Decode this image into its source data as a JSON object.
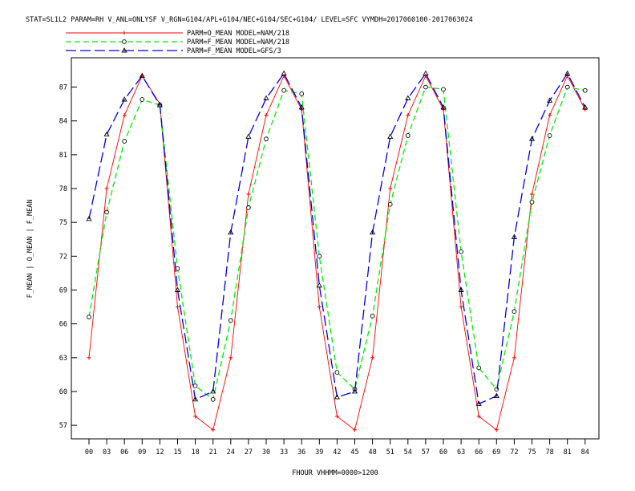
{
  "chart_data": {
    "type": "line",
    "title": "STAT=SL1L2 PARAM=RH V_ANL=ONLYSF V_RGN=G104/APL+G104/NEC+G104/SEC+G104/ LEVEL=SFC VYMDH=2017060100-2017063024",
    "xlabel": "FHOUR VHHMM=0000>1200",
    "ylabel": "F_MEAN | O_MEAN | F_MEAN",
    "categories": [
      "00",
      "03",
      "06",
      "09",
      "12",
      "15",
      "18",
      "21",
      "24",
      "27",
      "30",
      "33",
      "36",
      "39",
      "42",
      "45",
      "48",
      "51",
      "54",
      "57",
      "60",
      "63",
      "66",
      "69",
      "72",
      "75",
      "78",
      "81",
      "84"
    ],
    "y_ticks": [
      "57",
      "60",
      "63",
      "66",
      "69",
      "72",
      "75",
      "78",
      "81",
      "84",
      "87"
    ],
    "ylim": [
      55.8,
      89.6
    ],
    "grid": false,
    "legend_position": "top-left",
    "series": [
      {
        "name": "PARM=O_MEAN MODEL=NAM/218",
        "color": "#ff0000",
        "dash": "",
        "marker": "plus",
        "values": [
          63.0,
          78.0,
          84.5,
          88.0,
          85.5,
          67.5,
          57.8,
          56.6,
          63.0,
          77.5,
          84.5,
          88.0,
          85.0,
          67.5,
          57.8,
          56.6,
          63.0,
          78.0,
          84.5,
          88.0,
          85.0,
          67.5,
          57.8,
          56.6,
          63.0,
          77.5,
          84.5,
          88.0,
          85.0
        ]
      },
      {
        "name": "PARM=F_MEAN MODEL=NAM/218",
        "color": "#00ee00",
        "dash": "7,4",
        "marker": "circle",
        "values": [
          66.6,
          75.9,
          82.2,
          85.9,
          85.4,
          70.9,
          60.5,
          59.3,
          66.3,
          76.3,
          82.4,
          86.7,
          86.4,
          72.0,
          61.7,
          60.2,
          66.7,
          76.6,
          82.7,
          87.0,
          86.8,
          72.4,
          62.1,
          60.2,
          67.1,
          76.8,
          82.7,
          87.0,
          86.7
        ]
      },
      {
        "name": "PARM=F_MEAN MODEL=GFS/3",
        "color": "#0000dd",
        "dash": "13,5",
        "marker": "triangle",
        "values": [
          75.3,
          82.8,
          85.9,
          88.0,
          85.4,
          69.0,
          59.3,
          60.0,
          74.1,
          82.6,
          86.0,
          88.2,
          85.2,
          69.4,
          59.5,
          60.0,
          74.1,
          82.6,
          86.0,
          88.2,
          85.2,
          69.0,
          58.9,
          59.6,
          73.7,
          82.4,
          85.8,
          88.2,
          85.2
        ]
      }
    ]
  }
}
